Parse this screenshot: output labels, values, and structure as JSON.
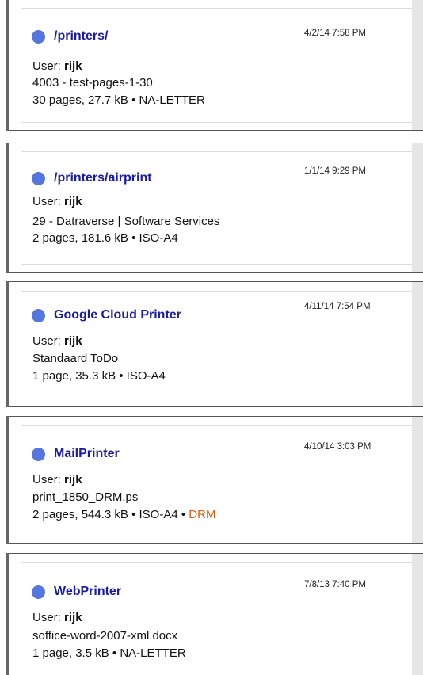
{
  "jobs": [
    {
      "printer": "/printers/",
      "timestamp": "4/2/14 7:58 PM",
      "user_label": "User: ",
      "user": "rijk",
      "document": "4003 - test-pages-1-30",
      "details": "30 pages, 27.7 kB • NA-LETTER",
      "flag": ""
    },
    {
      "printer": "/printers/airprint",
      "timestamp": "1/1/14 9:29 PM",
      "user_label": "User: ",
      "user": "rijk",
      "document": "29 - Datraverse | Software Services",
      "details": "2 pages, 181.6 kB • ISO-A4",
      "flag": ""
    },
    {
      "printer": "Google Cloud Printer",
      "timestamp": "4/11/14 7:54 PM",
      "user_label": "User: ",
      "user": "rijk",
      "document": "Standaard ToDo",
      "details": "1 page, 35.3 kB • ISO-A4",
      "flag": ""
    },
    {
      "printer": "MailPrinter",
      "timestamp": "4/10/14 3:03 PM",
      "user_label": "User: ",
      "user": "rijk",
      "document": "print_1850_DRM.ps",
      "details": "2 pages, 544.3 kB • ISO-A4 • ",
      "flag": "DRM"
    },
    {
      "printer": "WebPrinter",
      "timestamp": "7/8/13 7:40 PM",
      "user_label": "User: ",
      "user": "rijk",
      "document": "soffice-word-2007-xml.docx",
      "details": "1 page, 3.5 kB • NA-LETTER",
      "flag": ""
    }
  ],
  "colors": {
    "status_dot": "#5577dd",
    "printer_name": "#1a1aa6",
    "drm_flag": "#e05a10"
  },
  "icons": {
    "status": "status-dot-icon"
  }
}
